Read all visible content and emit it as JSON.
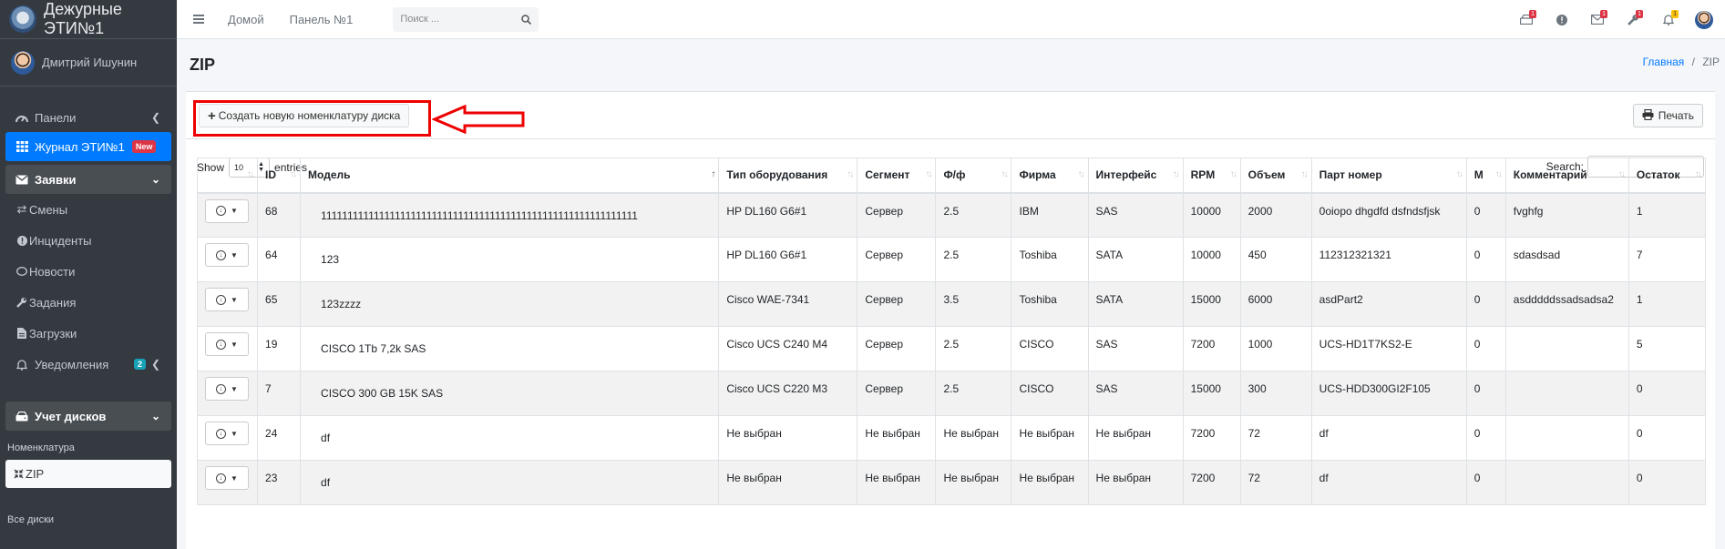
{
  "brand": {
    "title": "Дежурные ЭТИ№1"
  },
  "user": {
    "name": "Дмитрий Ишунин"
  },
  "sidebar": {
    "items": [
      {
        "label": "Панели",
        "icon": "dashboard-icon"
      },
      {
        "label": "Журнал ЭТИ№1",
        "icon": "grid-icon",
        "badge": "New"
      },
      {
        "label": "Заявки",
        "icon": "envelope-icon"
      },
      {
        "label": "Смены",
        "icon": "exchange-icon"
      },
      {
        "label": "Инциденты",
        "icon": "alert-icon"
      },
      {
        "label": "Новости",
        "icon": "chat-icon"
      },
      {
        "label": "Задания",
        "icon": "wrench-icon"
      },
      {
        "label": "Загрузки",
        "icon": "file-icon"
      },
      {
        "label": "Уведомления",
        "icon": "bell-icon",
        "badge": "2"
      },
      {
        "label": "Учет дисков",
        "icon": "hdd-icon"
      }
    ],
    "section_nomenclature": "Номенклатура",
    "zip_label": "ZIP",
    "section_all_disks": "Все диски"
  },
  "topbar": {
    "home": "Домой",
    "panel": "Панель №1",
    "search_placeholder": "Поиск ...",
    "badges": [
      "1",
      "1",
      "1",
      "1"
    ]
  },
  "page": {
    "title": "ZIP",
    "breadcrumb_home": "Главная",
    "breadcrumb_sep": "/",
    "breadcrumb_current": "ZIP"
  },
  "toolbar": {
    "create_label": "Создать новую номенклатуру диска",
    "print_label": "Печать"
  },
  "table_controls": {
    "show": "Show",
    "entries_value": "10",
    "entries": "entries",
    "search": "Search:"
  },
  "table": {
    "headers": [
      "",
      "ID",
      "Модель",
      "Тип оборудования",
      "Сегмент",
      "Ф/ф",
      "Фирма",
      "Интерфейс",
      "RPM",
      "Объем",
      "Парт номер",
      "М",
      "Комментарий",
      "Остаток"
    ],
    "rows": [
      [
        "68",
        "111111111111111111111111111111111111111111111111111111111111",
        "HP DL160 G6#1",
        "Сервер",
        "2.5",
        "IBM",
        "SAS",
        "10000",
        "2000",
        "0oiopo dhgdfd dsfndsfjsk",
        "0",
        "fvghfg",
        "1"
      ],
      [
        "64",
        "123",
        "HP DL160 G6#1",
        "Сервер",
        "2.5",
        "Toshiba",
        "SATA",
        "10000",
        "450",
        "112312321321",
        "0",
        "sdasdsad",
        "7"
      ],
      [
        "65",
        "123zzzz",
        "Cisco WAE-7341",
        "Сервер",
        "3.5",
        "Toshiba",
        "SATA",
        "15000",
        "6000",
        "asdPart2",
        "0",
        "asdddddssadsadsa2",
        "1"
      ],
      [
        "19",
        "CISCO 1Tb 7,2k SAS",
        "Cisco UCS C240 M4",
        "Сервер",
        "2.5",
        "CISCO",
        "SAS",
        "7200",
        "1000",
        "UCS-HD1T7KS2-E",
        "0",
        "",
        "5"
      ],
      [
        "7",
        "CISCO 300 GB 15K SAS",
        "Cisco UCS C220 M3",
        "Сервер",
        "2.5",
        "CISCO",
        "SAS",
        "15000",
        "300",
        "UCS-HDD300GI2F105",
        "0",
        "",
        "0"
      ],
      [
        "24",
        "df",
        "Не выбран",
        "Не выбран",
        "Не выбран",
        "Не выбран",
        "Не выбран",
        "7200",
        "72",
        "df",
        "0",
        "",
        "0"
      ],
      [
        "23",
        "df",
        "Не выбран",
        "Не выбран",
        "Не выбран",
        "Не выбран",
        "Не выбран",
        "7200",
        "72",
        "df",
        "0",
        "",
        "0"
      ]
    ]
  },
  "colors": {
    "sidebar": "#343a40",
    "accent": "#007bff",
    "highlight": "#e00000"
  }
}
